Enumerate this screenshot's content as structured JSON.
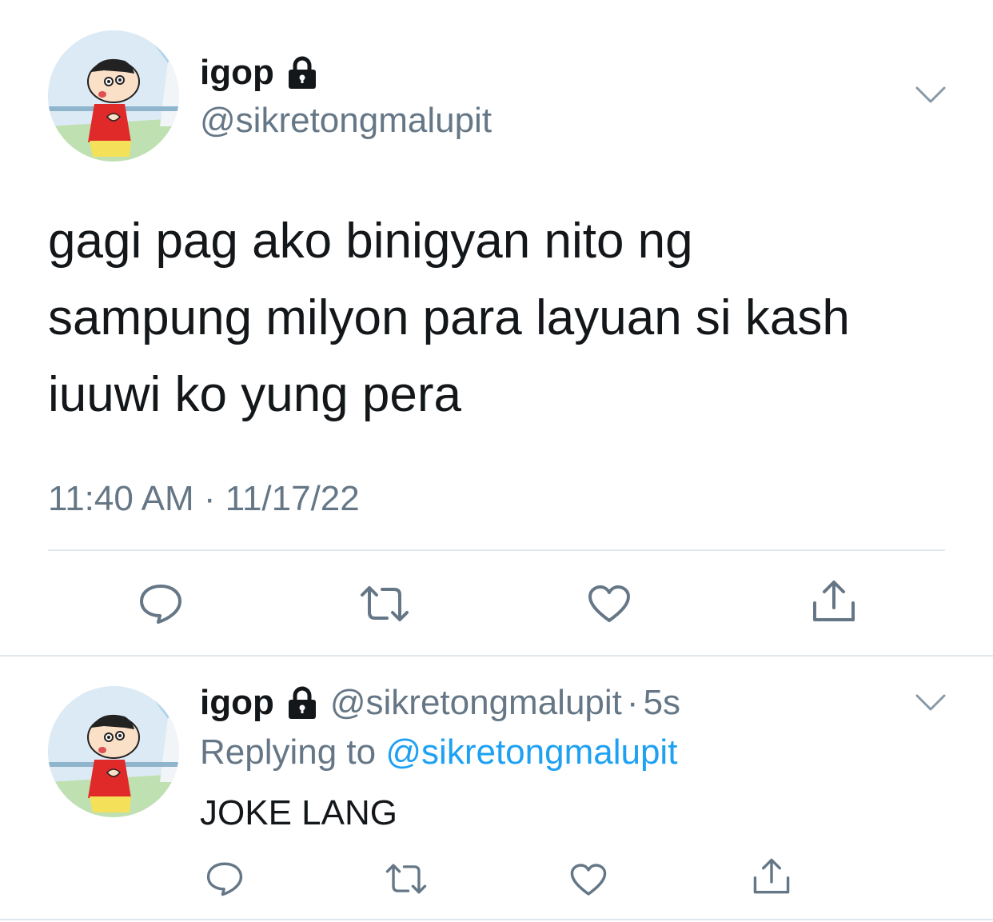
{
  "main_tweet": {
    "display_name": "igop",
    "handle": "@sikretongmalupit",
    "text": "gagi pag ako binigyan nito ng\nsampung milyon para layuan si kash\niuuwi ko yung pera",
    "timestamp": "11:40 AM · 11/17/22",
    "avatar_icon": "cartoon-avatar",
    "protected_icon": "lock-icon",
    "actions": [
      "reply-icon",
      "retweet-icon",
      "like-icon",
      "share-icon"
    ]
  },
  "reply_tweet": {
    "display_name": "igop",
    "handle": "@sikretongmalupit",
    "separator": "·",
    "time": "5s",
    "replying_prefix": "Replying to",
    "replying_to": "@sikretongmalupit",
    "text": "JOKE LANG",
    "avatar_icon": "cartoon-avatar",
    "protected_icon": "lock-icon",
    "actions": [
      "reply-icon",
      "retweet-icon",
      "like-icon",
      "share-icon"
    ]
  },
  "colors": {
    "primary_text": "#14171a",
    "secondary_text": "#657786",
    "link": "#1da1f2",
    "divider": "#e1e8ed"
  }
}
